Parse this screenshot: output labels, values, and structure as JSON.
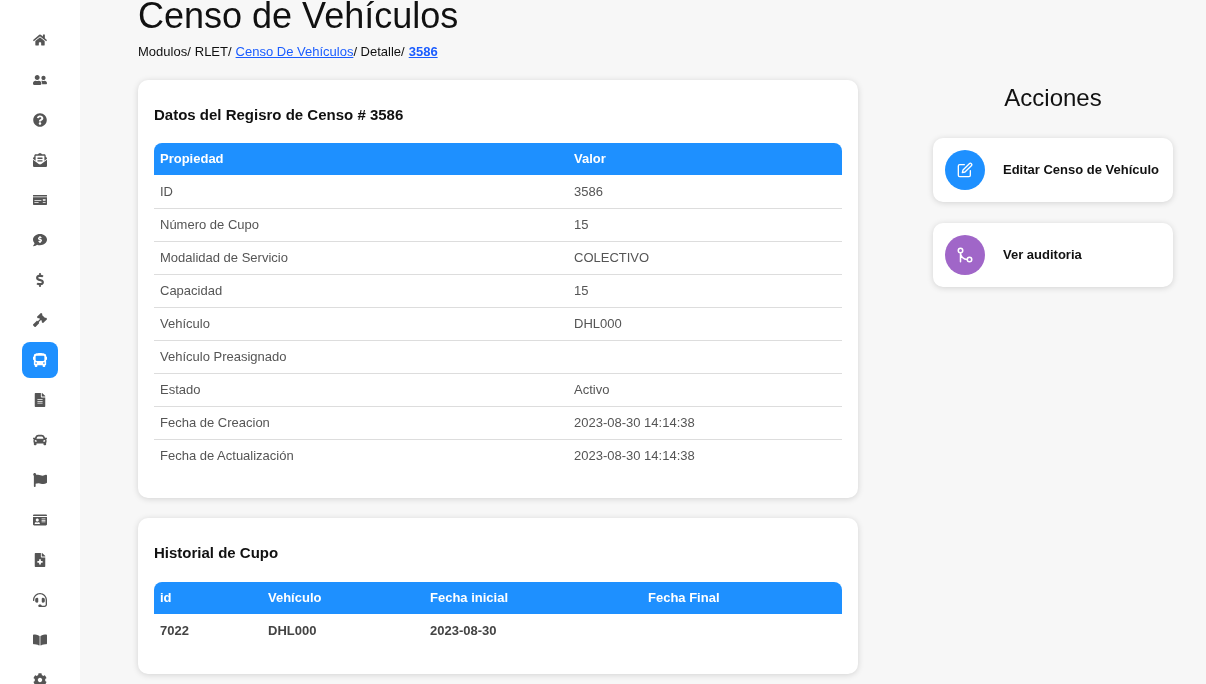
{
  "sidebar": {
    "items": [
      {
        "selected": false
      },
      {
        "selected": false
      },
      {
        "selected": false
      },
      {
        "selected": false
      },
      {
        "selected": false
      },
      {
        "selected": false
      },
      {
        "selected": false
      },
      {
        "selected": false
      },
      {
        "selected": true
      },
      {
        "selected": false
      },
      {
        "selected": false
      },
      {
        "selected": false
      },
      {
        "selected": false
      },
      {
        "selected": false
      },
      {
        "selected": false
      },
      {
        "selected": false
      },
      {
        "selected": false
      }
    ]
  },
  "page": {
    "title": "Censo de Vehículos",
    "breadcrumb": [
      {
        "kind": "text",
        "text": "Modulos/"
      },
      {
        "kind": "text",
        "text": "RLET/"
      },
      {
        "kind": "link",
        "text": "Censo De Vehículos"
      },
      {
        "kind": "text",
        "text": "/ Detalle/"
      },
      {
        "kind": "current",
        "text": "3586"
      }
    ]
  },
  "details": {
    "title": "Datos del Regisro de Censo # 3586",
    "columns": [
      "Propiedad",
      "Valor"
    ],
    "rows": [
      [
        "ID",
        "3586"
      ],
      [
        "Número de Cupo",
        "15"
      ],
      [
        "Modalidad de Servicio",
        "COLECTIVO"
      ],
      [
        "Capacidad",
        "15"
      ],
      [
        "Vehículo",
        "DHL000"
      ],
      [
        "Vehículo Preasignado",
        ""
      ],
      [
        "Estado",
        "Activo"
      ],
      [
        "Fecha de Creacion",
        "2023-08-30 14:14:38"
      ],
      [
        "Fecha de Actualización",
        "2023-08-30 14:14:38"
      ]
    ]
  },
  "history": {
    "title": "Historial de Cupo",
    "columns": [
      "id",
      "Vehículo",
      "Fecha inicial",
      "Fecha Final"
    ],
    "rows": [
      [
        "7022",
        "DHL000",
        "2023-08-30",
        ""
      ]
    ]
  },
  "actions": {
    "title": "Acciones",
    "items": [
      {
        "kind": "edit",
        "label": "Editar Censo de Vehículo",
        "color": "#1e90ff"
      },
      {
        "kind": "audit",
        "label": "Ver auditoria",
        "color": "#a066c8"
      }
    ]
  }
}
